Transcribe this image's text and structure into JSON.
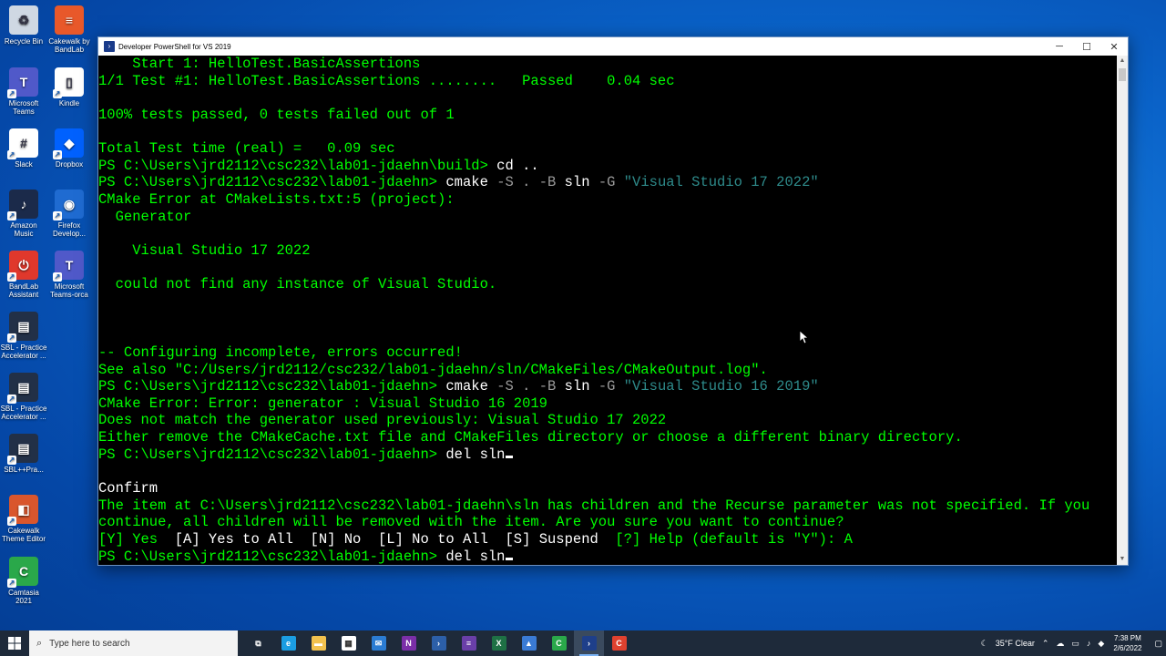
{
  "desktop": {
    "icons": [
      {
        "label": "Recycle Bin",
        "icon": "recycle-bin-icon",
        "color": "#cfd8e3"
      },
      {
        "label": "Cakewalk by BandLab",
        "icon": "cakewalk-icon",
        "color": "#e8582a"
      },
      {
        "label": "Microsoft Teams",
        "icon": "teams-icon",
        "color": "#5059c9"
      },
      {
        "label": "Kindle",
        "icon": "kindle-icon",
        "color": "#ffffff"
      },
      {
        "label": "Slack",
        "icon": "slack-icon",
        "color": "#ffffff"
      },
      {
        "label": "Dropbox",
        "icon": "dropbox-icon",
        "color": "#0061fe"
      },
      {
        "label": "Amazon Music",
        "icon": "amazon-music-icon",
        "color": "#1b2a4a"
      },
      {
        "label": "Firefox Develop...",
        "icon": "firefox-icon",
        "color": "#1f6bd1"
      },
      {
        "label": "BandLab Assistant",
        "icon": "bandlab-icon",
        "color": "#e0382c"
      },
      {
        "label": "Microsoft Teams-orca",
        "icon": "teams-icon",
        "color": "#5059c9"
      },
      {
        "label": "SBL - Practice Accelerator ...",
        "icon": "book-icon",
        "color": "#223047"
      },
      {
        "label": "SBL - Practice Accelerator ...",
        "icon": "book-icon",
        "color": "#223047"
      },
      {
        "label": "SBL++Pra...",
        "icon": "book-icon",
        "color": "#223047"
      },
      {
        "label": "Cakewalk Theme Editor",
        "icon": "theme-editor-icon",
        "color": "#d9562d"
      },
      {
        "label": "Camtasia 2021",
        "icon": "camtasia-icon",
        "color": "#2aa84a"
      }
    ]
  },
  "window": {
    "title": "Developer PowerShell for VS 2019",
    "controls": {
      "minimize": "─",
      "maximize": "☐",
      "close": "✕"
    }
  },
  "console": {
    "lines": [
      [
        {
          "t": "    Start 1: HelloTest.BasicAssertions",
          "c": ""
        }
      ],
      [
        {
          "t": "1/1 Test #1: HelloTest.BasicAssertions ........   Passed    0.04 sec",
          "c": ""
        }
      ],
      [
        {
          "t": "",
          "c": ""
        }
      ],
      [
        {
          "t": "100% tests passed, 0 tests failed out of 1",
          "c": ""
        }
      ],
      [
        {
          "t": "",
          "c": ""
        }
      ],
      [
        {
          "t": "Total Test time (real) =   0.09 sec",
          "c": ""
        }
      ],
      [
        {
          "t": "PS C:\\Users\\jrd2112\\csc232\\lab01-jdaehn\\build> ",
          "c": ""
        },
        {
          "t": "cd ..",
          "c": "c-white"
        }
      ],
      [
        {
          "t": "PS C:\\Users\\jrd2112\\csc232\\lab01-jdaehn> ",
          "c": ""
        },
        {
          "t": "cmake",
          "c": "c-white"
        },
        {
          "t": " -S . -B ",
          "c": "c-gray"
        },
        {
          "t": "sln",
          "c": "c-white"
        },
        {
          "t": " -G ",
          "c": "c-gray"
        },
        {
          "t": "\"Visual Studio 17 2022\"",
          "c": "c-teal"
        }
      ],
      [
        {
          "t": "CMake Error at CMakeLists.txt:5 (project):",
          "c": ""
        }
      ],
      [
        {
          "t": "  Generator",
          "c": ""
        }
      ],
      [
        {
          "t": "",
          "c": ""
        }
      ],
      [
        {
          "t": "    Visual Studio 17 2022",
          "c": ""
        }
      ],
      [
        {
          "t": "",
          "c": ""
        }
      ],
      [
        {
          "t": "  could not find any instance of Visual Studio.",
          "c": ""
        }
      ],
      [
        {
          "t": "",
          "c": ""
        }
      ],
      [
        {
          "t": "",
          "c": ""
        }
      ],
      [
        {
          "t": "",
          "c": ""
        }
      ],
      [
        {
          "t": "-- Configuring incomplete, errors occurred!",
          "c": ""
        }
      ],
      [
        {
          "t": "See also \"C:/Users/jrd2112/csc232/lab01-jdaehn/sln/CMakeFiles/CMakeOutput.log\".",
          "c": ""
        }
      ],
      [
        {
          "t": "PS C:\\Users\\jrd2112\\csc232\\lab01-jdaehn> ",
          "c": ""
        },
        {
          "t": "cmake",
          "c": "c-white"
        },
        {
          "t": " -S . -B ",
          "c": "c-gray"
        },
        {
          "t": "sln",
          "c": "c-white"
        },
        {
          "t": " -G ",
          "c": "c-gray"
        },
        {
          "t": "\"Visual Studio 16 2019\"",
          "c": "c-teal"
        }
      ],
      [
        {
          "t": "CMake Error: Error: generator : Visual Studio 16 2019",
          "c": ""
        }
      ],
      [
        {
          "t": "Does not match the generator used previously: Visual Studio 17 2022",
          "c": ""
        }
      ],
      [
        {
          "t": "Either remove the CMakeCache.txt file and CMakeFiles directory or choose a different binary directory.",
          "c": ""
        }
      ],
      [
        {
          "t": "PS C:\\Users\\jrd2112\\csc232\\lab01-jdaehn> ",
          "c": ""
        },
        {
          "t": "del sln",
          "c": "c-white"
        },
        {
          "t": "",
          "c": "cursor"
        }
      ],
      [
        {
          "t": "",
          "c": ""
        }
      ],
      [
        {
          "t": "Confirm",
          "c": "c-white"
        }
      ],
      [
        {
          "t": "The item at C:\\Users\\jrd2112\\csc232\\lab01-jdaehn\\sln has children and the Recurse parameter was not specified. If you",
          "c": ""
        }
      ],
      [
        {
          "t": "continue, all children will be removed with the item. Are you sure you want to continue?",
          "c": ""
        }
      ],
      [
        {
          "t": "[Y] Yes",
          "c": ""
        },
        {
          "t": "  [A] Yes to All  [N] No  [L] No to All  [S] Suspend  ",
          "c": "c-white"
        },
        {
          "t": "[?] Help (default is \"Y\"): A",
          "c": ""
        }
      ],
      [
        {
          "t": "PS C:\\Users\\jrd2112\\csc232\\lab01-jdaehn> ",
          "c": ""
        },
        {
          "t": "del sln",
          "c": "c-white"
        },
        {
          "t": "",
          "c": "cursor"
        }
      ]
    ]
  },
  "taskbar": {
    "search_placeholder": "Type here to search",
    "apps": [
      {
        "icon": "task-view-icon",
        "glyph": "⧉",
        "color": "transparent"
      },
      {
        "icon": "edge-icon",
        "glyph": "e",
        "color": "#1b9de2"
      },
      {
        "icon": "file-explorer-icon",
        "glyph": "▬",
        "color": "#f2c14e"
      },
      {
        "icon": "store-icon",
        "glyph": "▦",
        "color": "#ffffff"
      },
      {
        "icon": "mail-icon",
        "glyph": "✉",
        "color": "#2b7cd3"
      },
      {
        "icon": "onenote-icon",
        "glyph": "N",
        "color": "#7b2fa8"
      },
      {
        "icon": "powershell-icon",
        "glyph": "›",
        "color": "#2c5fa8"
      },
      {
        "icon": "visual-studio-icon",
        "glyph": "≡",
        "color": "#6a3fa8"
      },
      {
        "icon": "excel-icon",
        "glyph": "X",
        "color": "#1e7145"
      },
      {
        "icon": "triangle-app-icon",
        "glyph": "▲",
        "color": "#3a7bd5"
      },
      {
        "icon": "camtasia-icon",
        "glyph": "C",
        "color": "#2aa84a"
      },
      {
        "icon": "developer-powershell-icon",
        "glyph": "›",
        "color": "#1e3f8a",
        "active": true
      },
      {
        "icon": "clion-icon",
        "glyph": "C",
        "color": "#e0412f"
      }
    ],
    "tray": {
      "weather": "35°F  Clear",
      "time": "7:38 PM",
      "date": "2/6/2022"
    }
  }
}
